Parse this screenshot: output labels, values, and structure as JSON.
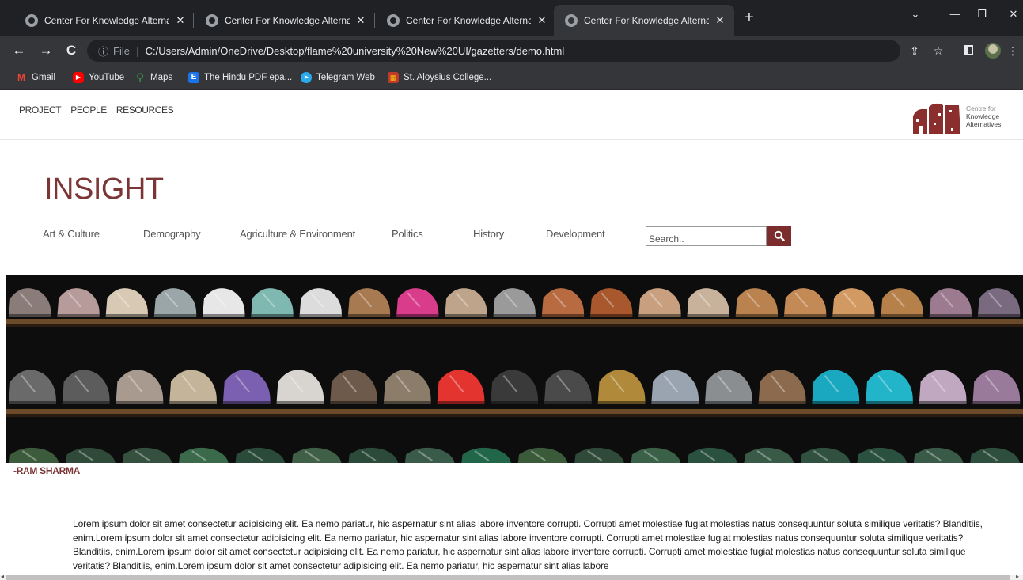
{
  "browser": {
    "tabs": [
      {
        "title": "Center For Knowledge Alternative",
        "active": false
      },
      {
        "title": "Center For Knowledge Alternative",
        "active": false
      },
      {
        "title": "Center For Knowledge Alternative",
        "active": false
      },
      {
        "title": "Center For Knowledge Alternative",
        "active": true
      }
    ],
    "address": {
      "scheme_label": "File",
      "url": "C:/Users/Admin/OneDrive/Desktop/flame%20university%20New%20UI/gazetters/demo.html"
    },
    "bookmarks": [
      {
        "label": "Gmail",
        "icon": "gmail-icon"
      },
      {
        "label": "YouTube",
        "icon": "youtube-icon"
      },
      {
        "label": "Maps",
        "icon": "maps-icon"
      },
      {
        "label": "The Hindu PDF epa...",
        "icon": "hindu-icon"
      },
      {
        "label": "Telegram Web",
        "icon": "telegram-icon"
      },
      {
        "label": "St. Aloysius College...",
        "icon": "college-icon"
      }
    ]
  },
  "site": {
    "topnav": [
      "PROJECT",
      "PEOPLE",
      "RESOURCES"
    ],
    "logo": {
      "line1": "Centre for",
      "line2": "Knowledge",
      "line3": "Alternatives"
    },
    "heading": "INSIGHT",
    "categories": [
      "Art & Culture",
      "Demography",
      "Agriculture & Environment",
      "Politics",
      "History",
      "Development"
    ],
    "search": {
      "placeholder": "Search.."
    },
    "author": "-RAM SHARMA",
    "body": "Lorem ipsum dolor sit amet consectetur adipisicing elit. Ea nemo pariatur, hic aspernatur sint alias labore inventore corrupti. Corrupti amet molestiae fugiat molestias natus consequuntur soluta similique veritatis? Blanditiis, enim.Lorem ipsum dolor sit amet consectetur adipisicing elit. Ea nemo pariatur, hic aspernatur sint alias labore inventore corrupti. Corrupti amet molestiae fugiat molestias natus consequuntur soluta similique veritatis? Blanditiis, enim.Lorem ipsum dolor sit amet consectetur adipisicing elit. Ea nemo pariatur, hic aspernatur sint alias labore inventore corrupti. Corrupti amet molestiae fugiat molestias natus consequuntur soluta similique veritatis? Blanditiis, enim.Lorem ipsum dolor sit amet consectetur adipisicing elit. Ea nemo pariatur, hic aspernatur sint alias labore"
  },
  "colors": {
    "accent": "#7b3535",
    "search_button": "#7b2d2d",
    "chrome_dark": "#202124",
    "chrome_toolbar": "#35363a"
  }
}
